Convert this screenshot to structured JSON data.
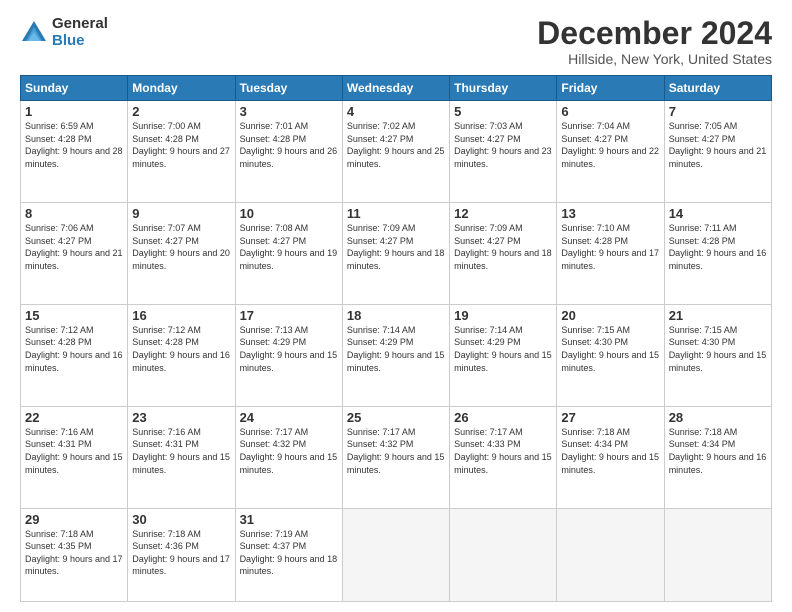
{
  "logo": {
    "general": "General",
    "blue": "Blue"
  },
  "title": "December 2024",
  "subtitle": "Hillside, New York, United States",
  "days_of_week": [
    "Sunday",
    "Monday",
    "Tuesday",
    "Wednesday",
    "Thursday",
    "Friday",
    "Saturday"
  ],
  "weeks": [
    [
      {
        "day": 1,
        "sunrise": "6:59 AM",
        "sunset": "4:28 PM",
        "daylight": "9 hours and 28 minutes."
      },
      {
        "day": 2,
        "sunrise": "7:00 AM",
        "sunset": "4:28 PM",
        "daylight": "9 hours and 27 minutes."
      },
      {
        "day": 3,
        "sunrise": "7:01 AM",
        "sunset": "4:28 PM",
        "daylight": "9 hours and 26 minutes."
      },
      {
        "day": 4,
        "sunrise": "7:02 AM",
        "sunset": "4:27 PM",
        "daylight": "9 hours and 25 minutes."
      },
      {
        "day": 5,
        "sunrise": "7:03 AM",
        "sunset": "4:27 PM",
        "daylight": "9 hours and 23 minutes."
      },
      {
        "day": 6,
        "sunrise": "7:04 AM",
        "sunset": "4:27 PM",
        "daylight": "9 hours and 22 minutes."
      },
      {
        "day": 7,
        "sunrise": "7:05 AM",
        "sunset": "4:27 PM",
        "daylight": "9 hours and 21 minutes."
      }
    ],
    [
      {
        "day": 8,
        "sunrise": "7:06 AM",
        "sunset": "4:27 PM",
        "daylight": "9 hours and 21 minutes."
      },
      {
        "day": 9,
        "sunrise": "7:07 AM",
        "sunset": "4:27 PM",
        "daylight": "9 hours and 20 minutes."
      },
      {
        "day": 10,
        "sunrise": "7:08 AM",
        "sunset": "4:27 PM",
        "daylight": "9 hours and 19 minutes."
      },
      {
        "day": 11,
        "sunrise": "7:09 AM",
        "sunset": "4:27 PM",
        "daylight": "9 hours and 18 minutes."
      },
      {
        "day": 12,
        "sunrise": "7:09 AM",
        "sunset": "4:27 PM",
        "daylight": "9 hours and 18 minutes."
      },
      {
        "day": 13,
        "sunrise": "7:10 AM",
        "sunset": "4:28 PM",
        "daylight": "9 hours and 17 minutes."
      },
      {
        "day": 14,
        "sunrise": "7:11 AM",
        "sunset": "4:28 PM",
        "daylight": "9 hours and 16 minutes."
      }
    ],
    [
      {
        "day": 15,
        "sunrise": "7:12 AM",
        "sunset": "4:28 PM",
        "daylight": "9 hours and 16 minutes."
      },
      {
        "day": 16,
        "sunrise": "7:12 AM",
        "sunset": "4:28 PM",
        "daylight": "9 hours and 16 minutes."
      },
      {
        "day": 17,
        "sunrise": "7:13 AM",
        "sunset": "4:29 PM",
        "daylight": "9 hours and 15 minutes."
      },
      {
        "day": 18,
        "sunrise": "7:14 AM",
        "sunset": "4:29 PM",
        "daylight": "9 hours and 15 minutes."
      },
      {
        "day": 19,
        "sunrise": "7:14 AM",
        "sunset": "4:29 PM",
        "daylight": "9 hours and 15 minutes."
      },
      {
        "day": 20,
        "sunrise": "7:15 AM",
        "sunset": "4:30 PM",
        "daylight": "9 hours and 15 minutes."
      },
      {
        "day": 21,
        "sunrise": "7:15 AM",
        "sunset": "4:30 PM",
        "daylight": "9 hours and 15 minutes."
      }
    ],
    [
      {
        "day": 22,
        "sunrise": "7:16 AM",
        "sunset": "4:31 PM",
        "daylight": "9 hours and 15 minutes."
      },
      {
        "day": 23,
        "sunrise": "7:16 AM",
        "sunset": "4:31 PM",
        "daylight": "9 hours and 15 minutes."
      },
      {
        "day": 24,
        "sunrise": "7:17 AM",
        "sunset": "4:32 PM",
        "daylight": "9 hours and 15 minutes."
      },
      {
        "day": 25,
        "sunrise": "7:17 AM",
        "sunset": "4:32 PM",
        "daylight": "9 hours and 15 minutes."
      },
      {
        "day": 26,
        "sunrise": "7:17 AM",
        "sunset": "4:33 PM",
        "daylight": "9 hours and 15 minutes."
      },
      {
        "day": 27,
        "sunrise": "7:18 AM",
        "sunset": "4:34 PM",
        "daylight": "9 hours and 15 minutes."
      },
      {
        "day": 28,
        "sunrise": "7:18 AM",
        "sunset": "4:34 PM",
        "daylight": "9 hours and 16 minutes."
      }
    ],
    [
      {
        "day": 29,
        "sunrise": "7:18 AM",
        "sunset": "4:35 PM",
        "daylight": "9 hours and 17 minutes."
      },
      {
        "day": 30,
        "sunrise": "7:18 AM",
        "sunset": "4:36 PM",
        "daylight": "9 hours and 17 minutes."
      },
      {
        "day": 31,
        "sunrise": "7:19 AM",
        "sunset": "4:37 PM",
        "daylight": "9 hours and 18 minutes."
      },
      null,
      null,
      null,
      null
    ]
  ],
  "labels": {
    "sunrise": "Sunrise:",
    "sunset": "Sunset:",
    "daylight": "Daylight:"
  }
}
